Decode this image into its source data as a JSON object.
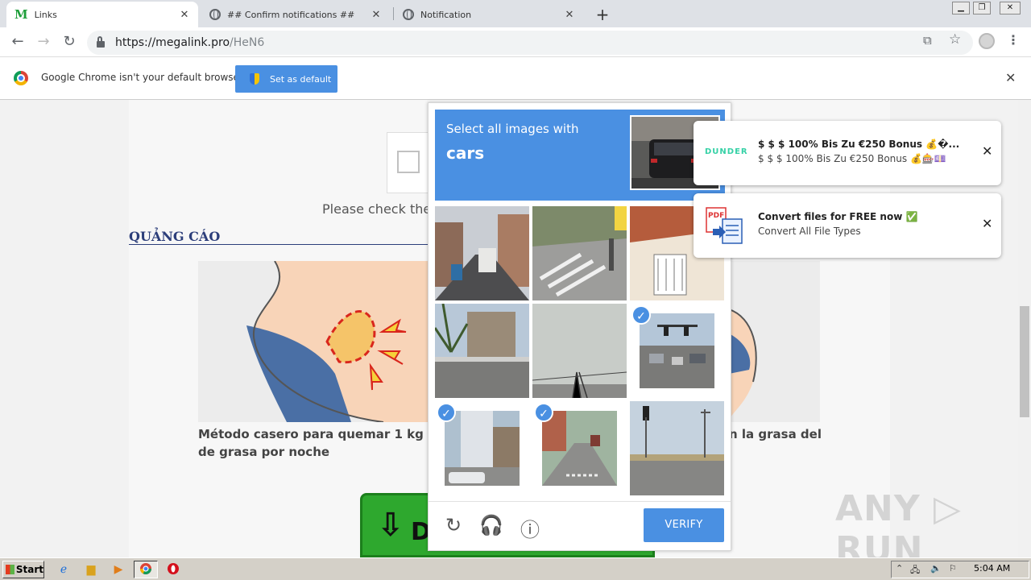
{
  "browser": {
    "tabs": [
      {
        "title": "Links",
        "active": true
      },
      {
        "title": "## Confirm notifications ##",
        "active": false
      },
      {
        "title": "Notification",
        "active": false
      }
    ],
    "url_host": "https://megalink.pro",
    "url_path": "/HeN6"
  },
  "infobar": {
    "message": "Google Chrome isn't your default browser",
    "button_label": "Set as default"
  },
  "page": {
    "please_check": "Please check the c",
    "ad_heading": "QUẢNG CÁO",
    "ad1_caption": "Método casero para quemar 1 kg de grasa por noche",
    "ad2_caption": "n la grasa del",
    "download_label": "D"
  },
  "captcha": {
    "instruction": "Select all images with",
    "object": "cars",
    "verify_label": "VERIFY",
    "selected_tiles": [
      6,
      7,
      8
    ]
  },
  "notifications": [
    {
      "title": "$ $ $ 100% Bis Zu €250 Bonus 💰�...",
      "body": "$ $ $ 100% Bis Zu €250 Bonus 💰🎰💷",
      "logo": "DUNDER"
    },
    {
      "title": "Convert files for FREE now ✅",
      "body": "Convert All File Types",
      "logo": "PDF"
    }
  ],
  "watermark": "ANY ▷ RUN",
  "taskbar": {
    "start_label": "Start",
    "clock": "5:04 AM"
  },
  "colors": {
    "accent": "#4a90e2",
    "download_green": "#2ea82e"
  }
}
